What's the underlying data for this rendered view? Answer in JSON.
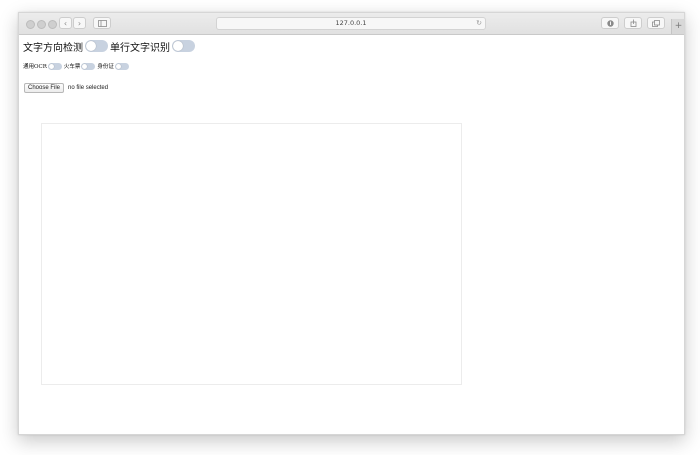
{
  "browser": {
    "address": "127.0.0.1",
    "icons": {
      "back": "chevron-left-icon",
      "forward": "chevron-right-icon",
      "sidebar": "sidebar-icon",
      "reload": "reload-icon",
      "downloads": "download-icon",
      "share": "share-icon",
      "tabs": "tabs-icon",
      "new_tab": "plus-icon"
    }
  },
  "page": {
    "toggles_main": [
      {
        "label": "文字方向检测",
        "on": false
      },
      {
        "label": "单行文字识别",
        "on": false
      }
    ],
    "toggles_mode": [
      {
        "label": "通用OCR",
        "on": false
      },
      {
        "label": "火车票",
        "on": false
      },
      {
        "label": "身份证",
        "on": false
      }
    ],
    "file_input": {
      "button_label": "Choose File",
      "status": "no file selected"
    }
  },
  "colors": {
    "toggle_off": "#c8d2e0",
    "window_border": "#d6d6d6"
  }
}
